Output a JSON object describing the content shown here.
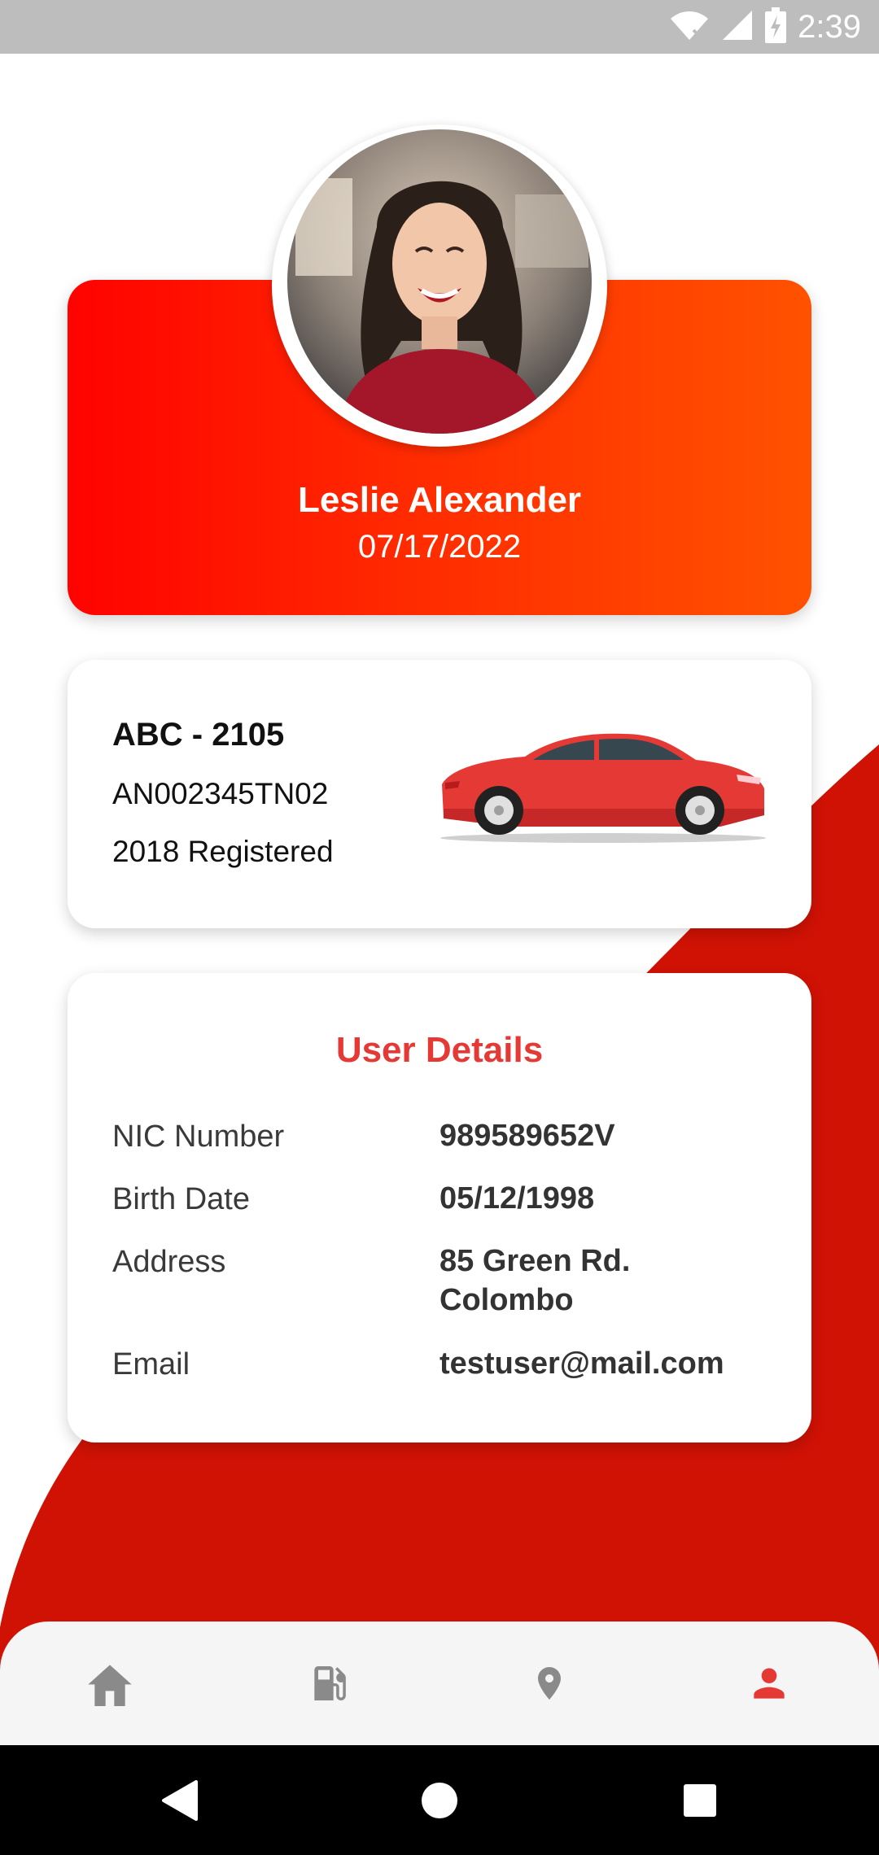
{
  "status_bar": {
    "time": "2:39",
    "icons": [
      "wifi-icon",
      "signal-icon",
      "battery-charging-icon"
    ]
  },
  "profile": {
    "name": "Leslie Alexander",
    "date": "07/17/2022",
    "avatar": "profile-photo"
  },
  "vehicle": {
    "plate": "ABC - 2105",
    "chassis": "AN002345TN02",
    "registered": "2018 Registered",
    "image": "red-car"
  },
  "user_details": {
    "title": "User Details",
    "rows": [
      {
        "label": "NIC Number",
        "value": "989589652V"
      },
      {
        "label": "Birth Date",
        "value": "05/12/1998"
      },
      {
        "label": "Address",
        "value_line1": "85 Green Rd.",
        "value_line2": "Colombo"
      },
      {
        "label": "Email",
        "value": "testuser@mail.com"
      }
    ]
  },
  "bottom_nav": {
    "items": [
      {
        "icon": "home-icon",
        "active": false
      },
      {
        "icon": "fuel-icon",
        "active": false
      },
      {
        "icon": "location-pin-icon",
        "active": false
      },
      {
        "icon": "person-icon",
        "active": true
      }
    ]
  },
  "colors": {
    "accent": "#e53935",
    "gradient_start": "#ff0200",
    "gradient_end": "#ff5200",
    "swoosh": "#d01205",
    "nav_inactive": "#8a8a8a"
  }
}
